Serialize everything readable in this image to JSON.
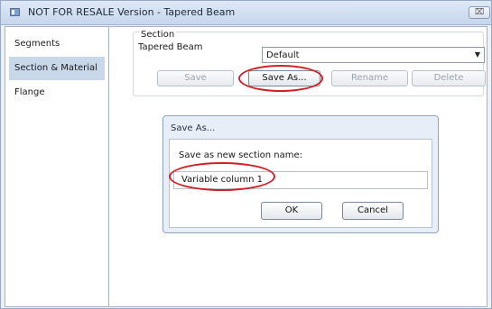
{
  "window": {
    "title": "NOT FOR RESALE Version - Tapered Beam",
    "close_glyph": "⌧"
  },
  "sidebar": {
    "items": [
      {
        "label": "Segments"
      },
      {
        "label": "Section & Material"
      },
      {
        "label": "Flange"
      }
    ],
    "selected": "Section & Material"
  },
  "section": {
    "group_title": "Section",
    "type_label": "Tapered Beam",
    "dropdown_value": "Default",
    "dropdown_arrow": "▼",
    "buttons": {
      "save": "Save",
      "save_as": "Save As...",
      "rename": "Rename",
      "delete": "Delete"
    }
  },
  "dialog": {
    "title": "Save As...",
    "prompt": "Save as new section name:",
    "name_value": "Variable column 1",
    "ok": "OK",
    "cancel": "Cancel"
  },
  "colors": {
    "annotation": "#d21f26",
    "selected_item": "#c9d7ea",
    "titlebar": "#c6d6ec"
  }
}
